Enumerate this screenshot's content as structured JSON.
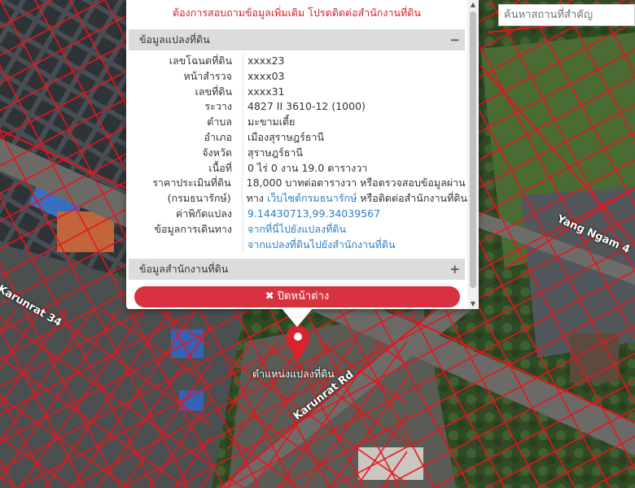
{
  "search": {
    "placeholder": "ค้นหาสถานที่สำคัญ"
  },
  "popup": {
    "notice": "ต้องการสอบถามข้อมูลเพิ่มเติม โปรดติดต่อสำนักงานที่ดิน",
    "parcel_section": {
      "title": "ข้อมูลแปลงที่ดิน",
      "toggle": "−",
      "rows": [
        {
          "label": "เลขโฉนดที่ดิน",
          "value": "xxxx23"
        },
        {
          "label": "หน้าสำรวจ",
          "value": "xxxx03"
        },
        {
          "label": "เลขที่ดิน",
          "value": "xxxx31"
        },
        {
          "label": "ระวาง",
          "value": "4827 II 3610-12 (1000)"
        },
        {
          "label": "ตำบล",
          "value": "มะขามเตี้ย"
        },
        {
          "label": "อำเภอ",
          "value": "เมืองสุราษฎร์ธานี"
        },
        {
          "label": "จังหวัด",
          "value": "สุราษฎร์ธานี"
        },
        {
          "label": "เนื้อที่",
          "value": "0 ไร่ 0 งาน 19.0 ตารางวา"
        }
      ],
      "price": {
        "label1": "ราคาประเมินที่ดิน",
        "label2": "(กรมธนารักษ์)",
        "line1": "18,000 บาทต่อตารางวา หรือตรวจสอบข้อมูลผ่าน",
        "line2_prefix": "ทาง ",
        "line2_link": "เว็บไซต์กรมธนารักษ์",
        "line2_suffix": " หรือติดต่อสำนักงานที่ดิน"
      },
      "coords": {
        "label": "ค่าพิกัดแปลง",
        "value": "9.14430713,99.34039567"
      },
      "travel": {
        "label": "ข้อมูลการเดินทาง",
        "link1": "จากที่นี่ไปยังแปลงที่ดิน",
        "link2": "จากแปลงที่ดินไปยังสำนักงานที่ดิน"
      }
    },
    "office_section": {
      "title": "ข้อมูลสำนักงานที่ดิน",
      "toggle": "+"
    },
    "close_button": "✖ ปิดหน้าต่าง"
  },
  "map": {
    "pin_label": "ตำแหน่งแปลงที่ดิน",
    "streets": [
      "Karunrat 34",
      "Karunrat Rd",
      "Yang Ngam 4"
    ],
    "colors": {
      "parcel_line": "#e8141b",
      "pin": "#d9232d",
      "accent_red": "#d2232a",
      "link": "#2d7fc4"
    }
  }
}
